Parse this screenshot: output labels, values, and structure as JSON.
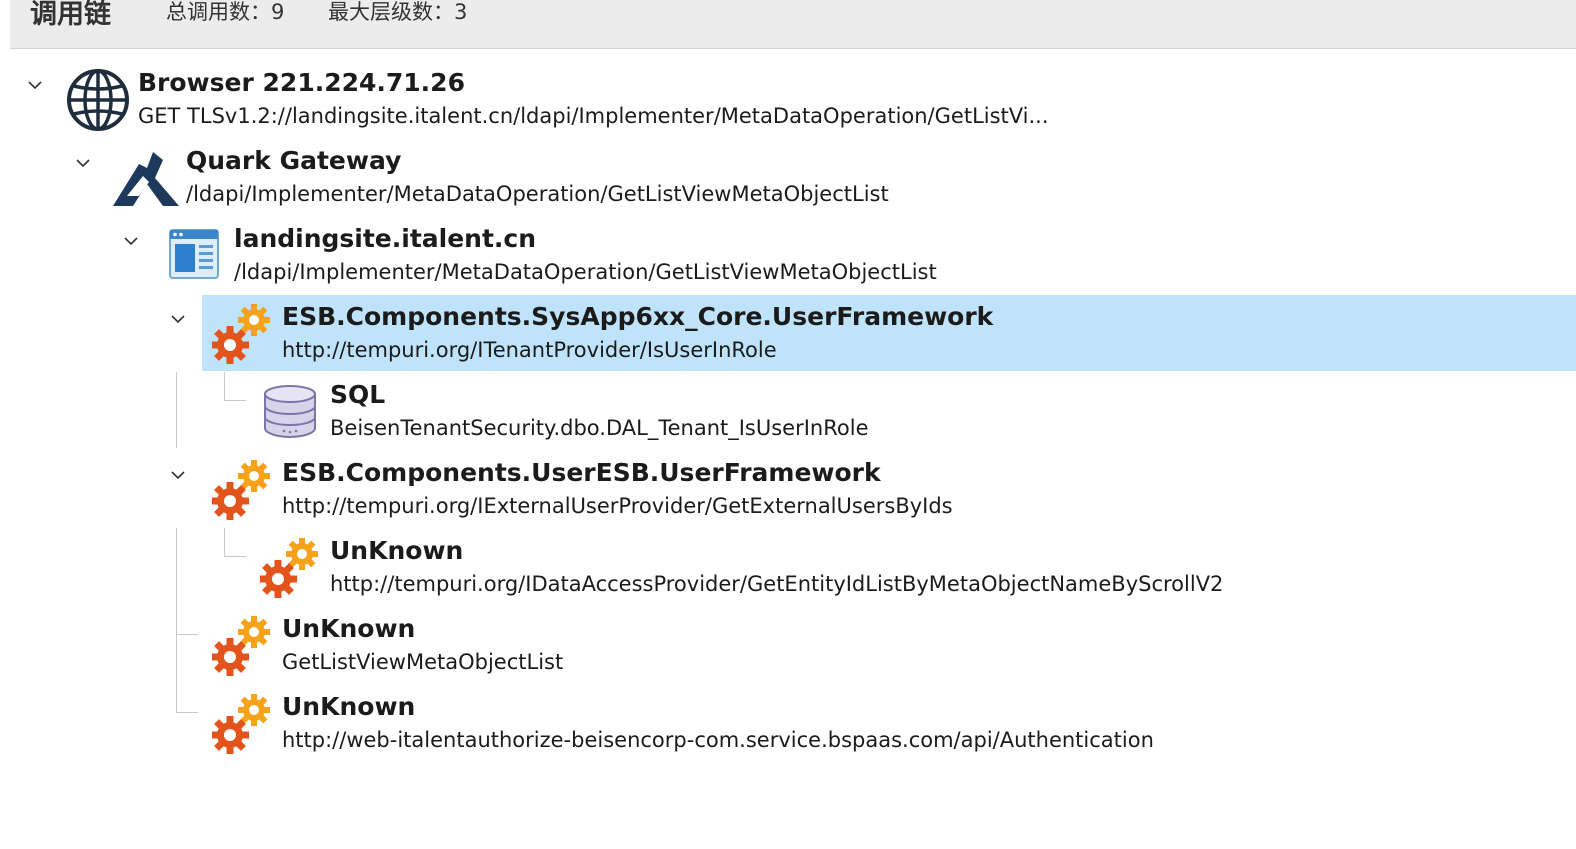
{
  "header": {
    "title": "调用链",
    "total_calls": "总调用数：9",
    "max_depth": "最大层级数：3"
  },
  "nodes": [
    {
      "name": "Browser 221.224.71.26",
      "detail": "GET TLSv1.2://landingsite.italent.cn/ldapi/Implementer/MetaDataOperation/GetListVi...",
      "icon": "globe-icon"
    },
    {
      "name": "Quark Gateway",
      "detail": "/ldapi/Implementer/MetaDataOperation/GetListViewMetaObjectList",
      "icon": "gateway-logo-icon"
    },
    {
      "name": "landingsite.italent.cn",
      "detail": "/ldapi/Implementer/MetaDataOperation/GetListViewMetaObjectList",
      "icon": "webpage-icon"
    },
    {
      "name": "ESB.Components.SysApp6xx_Core.UserFramework",
      "detail": "http://tempuri.org/ITenantProvider/IsUserInRole",
      "icon": "gears-icon",
      "selected": true
    },
    {
      "name": "SQL",
      "detail": "BeisenTenantSecurity.dbo.DAL_Tenant_IsUserInRole",
      "icon": "database-icon"
    },
    {
      "name": "ESB.Components.UserESB.UserFramework",
      "detail": "http://tempuri.org/IExternalUserProvider/GetExternalUsersByIds",
      "icon": "gears-icon"
    },
    {
      "name": "UnKnown",
      "detail": "http://tempuri.org/IDataAccessProvider/GetEntityIdListByMetaObjectNameByScrollV2",
      "icon": "gears-icon"
    },
    {
      "name": "UnKnown",
      "detail": "GetListViewMetaObjectList",
      "icon": "gears-icon"
    },
    {
      "name": "UnKnown",
      "detail": "http://web-italentauthorize-beisencorp-com.service.bspaas.com/api/Authentication",
      "icon": "gears-icon"
    }
  ],
  "colors": {
    "selection": "#bfe3fb",
    "gear_orange": "#f7a21b",
    "gear_red": "#e2541b",
    "globe": "#1f2d3d",
    "gateway": "#1d3a5c"
  }
}
